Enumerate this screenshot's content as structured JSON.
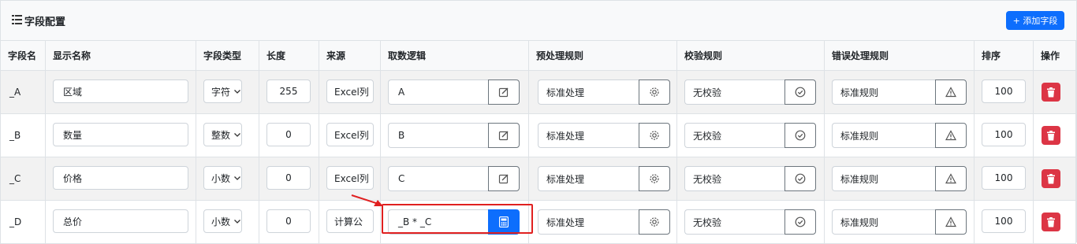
{
  "header": {
    "title": "字段配置",
    "add_button_label": "+ 添加字段"
  },
  "table": {
    "columns": [
      "字段名",
      "显示名称",
      "字段类型",
      "长度",
      "来源",
      "取数逻辑",
      "预处理规则",
      "校验规则",
      "错误处理规则",
      "排序",
      "操作"
    ],
    "rows": [
      {
        "name": "_A",
        "display": "区域",
        "type": "字符",
        "length": "255",
        "source": "Excel列",
        "logic": "A",
        "pre": "标准处理",
        "check": "无校验",
        "err": "标准规则",
        "order": "100"
      },
      {
        "name": "_B",
        "display": "数量",
        "type": "整数",
        "length": "0",
        "source": "Excel列",
        "logic": "B",
        "pre": "标准处理",
        "check": "无校验",
        "err": "标准规则",
        "order": "100"
      },
      {
        "name": "_C",
        "display": "价格",
        "type": "小数",
        "length": "0",
        "source": "Excel列",
        "logic": "C",
        "pre": "标准处理",
        "check": "无校验",
        "err": "标准规则",
        "order": "100"
      },
      {
        "name": "_D",
        "display": "总价",
        "type": "小数",
        "length": "0",
        "source": "计算公",
        "logic": "_B * _C",
        "pre": "标准处理",
        "check": "无校验",
        "err": "标准规则",
        "order": "100"
      }
    ]
  },
  "colors": {
    "primary": "#0d6efd",
    "danger": "#dc3545",
    "highlight": "#e02020"
  }
}
